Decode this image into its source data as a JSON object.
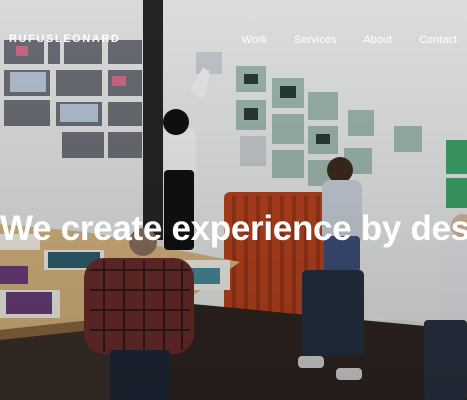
{
  "header": {
    "logo": "RUFUSLEONARD",
    "nav": [
      {
        "label": "Work"
      },
      {
        "label": "Services"
      },
      {
        "label": "About"
      },
      {
        "label": "Contact"
      }
    ]
  },
  "hero": {
    "headline": "We create experience by design"
  },
  "colors": {
    "text": "#ffffff",
    "radiator": "#b8431f",
    "wall": "#e9eaea"
  }
}
